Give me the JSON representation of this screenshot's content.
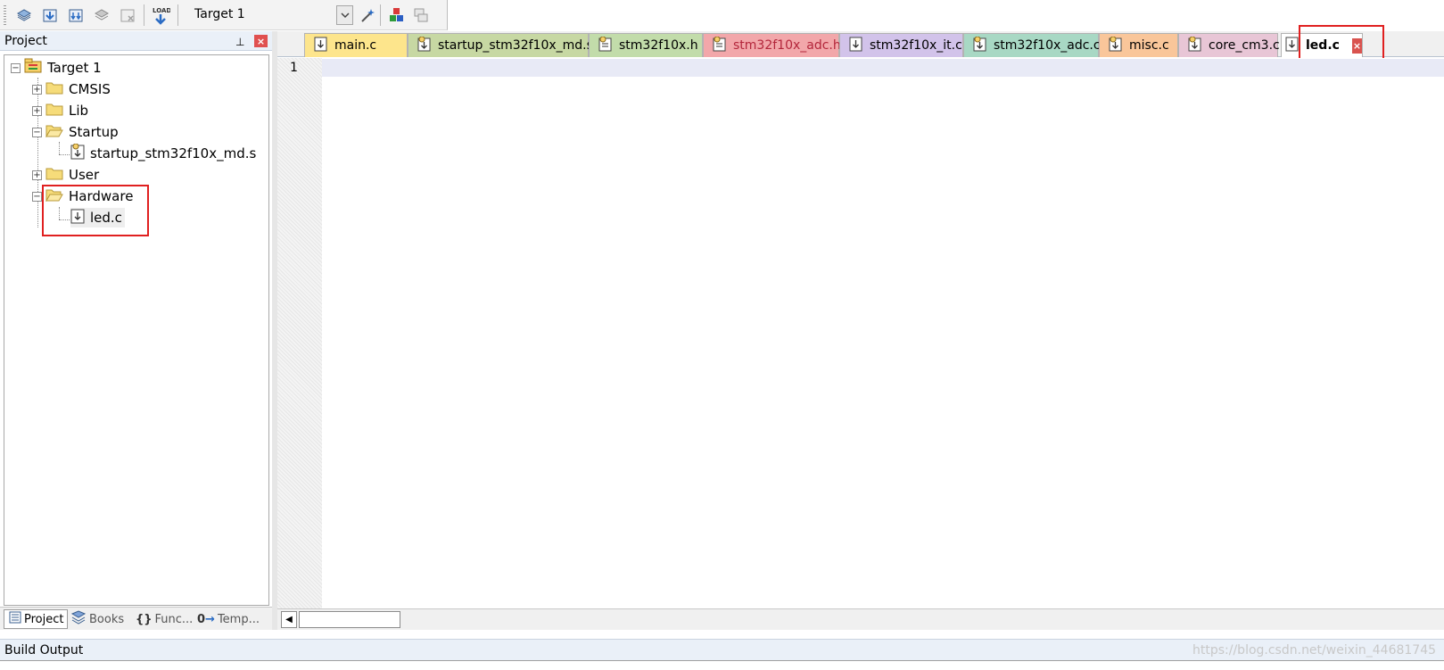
{
  "toolbar": {
    "target_value": "Target 1",
    "buttons": [
      "translate-icon",
      "build-icon",
      "rebuild-icon",
      "batch-build-icon",
      "stop-build-icon",
      "load-icon",
      "options-wand-icon",
      "manage-components-icon",
      "select-packs-icon"
    ],
    "load_text": "LOAD"
  },
  "project_panel": {
    "title": "Project",
    "pin_glyph": "⊥",
    "close_glyph": "×",
    "tree": {
      "root": "Target 1",
      "groups": [
        {
          "label": "CMSIS",
          "expanded": false
        },
        {
          "label": "Lib",
          "expanded": false
        },
        {
          "label": "Startup",
          "expanded": true,
          "files": [
            "startup_stm32f10x_md.s"
          ]
        },
        {
          "label": "User",
          "expanded": false
        },
        {
          "label": "Hardware",
          "expanded": true,
          "files": [
            "led.c"
          ]
        }
      ]
    },
    "bottom_tabs": [
      {
        "label": "Project",
        "active": true
      },
      {
        "label": "Books",
        "active": false
      },
      {
        "label": "Func...",
        "active": false
      },
      {
        "label": "Temp...",
        "active": false
      }
    ],
    "expander_glyphs": {
      "collapsed": "+",
      "expanded": "−"
    }
  },
  "editor": {
    "tabs": [
      {
        "label": "main.c",
        "color": "#fde58c"
      },
      {
        "label": "startup_stm32f10x_md.s",
        "color": "#c7d8a3"
      },
      {
        "label": "stm32f10x.h",
        "color": "#c2dcaa"
      },
      {
        "label": "stm32f10x_adc.h",
        "color": "#f2a7aa",
        "text_color": "#b3263b"
      },
      {
        "label": "stm32f10x_it.c",
        "color": "#d2c3ea"
      },
      {
        "label": "stm32f10x_adc.c",
        "color": "#a8d8c4"
      },
      {
        "label": "misc.c",
        "color": "#f9c69a"
      },
      {
        "label": "core_cm3.c",
        "color": "#e8c6d6"
      },
      {
        "label": "led.c",
        "color": "#ffffff",
        "active": true
      }
    ],
    "tab_close_glyph": "×",
    "line_numbers": [
      "1"
    ],
    "scroll_left_glyph": "◀"
  },
  "build_output": {
    "title": "Build Output"
  },
  "watermark": "https://blog.csdn.net/weixin_44681745",
  "colors": {
    "highlight": "#e02020",
    "current_line": "#e8eaf6",
    "panel_header": "#eaf0f8"
  }
}
